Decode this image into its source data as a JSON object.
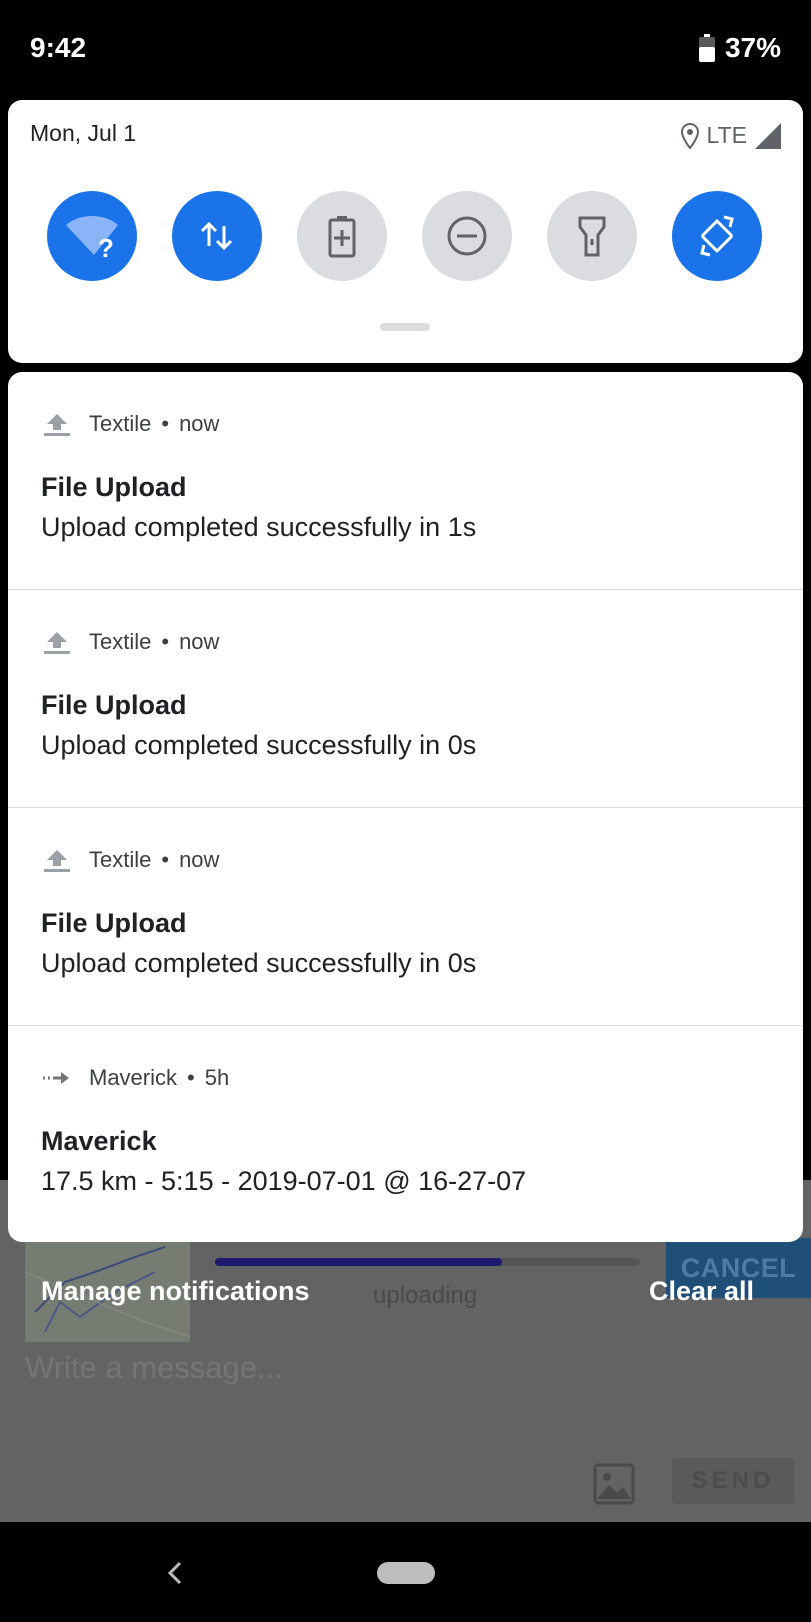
{
  "status_bar": {
    "time": "9:42",
    "battery": "37%"
  },
  "quick_settings": {
    "date": "Mon, Jul 1",
    "network": "LTE",
    "tiles": [
      {
        "icon": "wifi-icon",
        "state": "on"
      },
      {
        "icon": "mobile-data-icon",
        "state": "on"
      },
      {
        "icon": "battery-saver-icon",
        "state": "off"
      },
      {
        "icon": "do-not-disturb-icon",
        "state": "off"
      },
      {
        "icon": "flashlight-icon",
        "state": "off"
      },
      {
        "icon": "auto-rotate-icon",
        "state": "on"
      }
    ]
  },
  "notifications": [
    {
      "app": "Textile",
      "time": "now",
      "title": "File Upload",
      "text": "Upload completed successfully in 1s",
      "icon": "upload-icon"
    },
    {
      "app": "Textile",
      "time": "now",
      "title": "File Upload",
      "text": "Upload completed successfully in 0s",
      "icon": "upload-icon"
    },
    {
      "app": "Textile",
      "time": "now",
      "title": "File Upload",
      "text": "Upload completed successfully in 0s",
      "icon": "upload-icon"
    },
    {
      "app": "Maverick",
      "time": "5h",
      "title": "Maverick",
      "text": "17.5 km - 5:15 - 2019-07-01 @ 16-27-07",
      "icon": "arrow-right-icon"
    }
  ],
  "footer": {
    "manage": "Manage notifications",
    "clear_all": "Clear all"
  },
  "background_app": {
    "progress": 0.675,
    "uploading": "uploading",
    "cancel": "CANCEL",
    "message_placeholder": "Write a message...",
    "send": "SEND"
  },
  "colors": {
    "accent": "#1a73e8",
    "tile_off": "#dadce0"
  }
}
